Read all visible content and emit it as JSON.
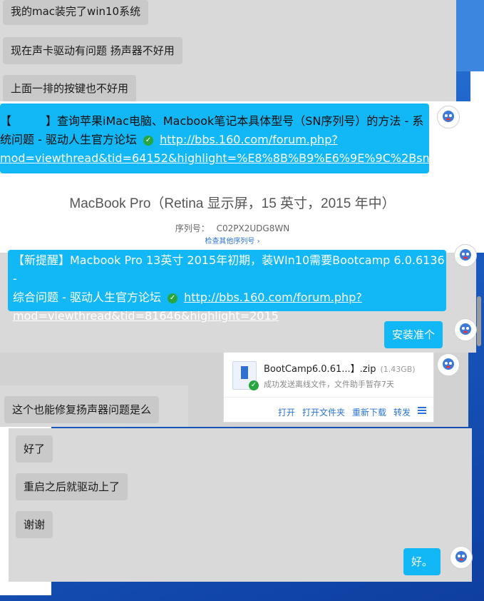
{
  "chat_top": {
    "messages": [
      "我的mac装完了win10系统",
      "现在声卡驱动有问题 扬声器不好用",
      "上面一排的按键也不好用"
    ]
  },
  "link_message_1": {
    "title": "【　　　】查询苹果iMac电脑、Macbook笔记本具体型号（SN序列号）的方法 - 系统问题 - 驱动人生官方论坛",
    "title_line1": "【　　　】查询苹果iMac电脑、Macbook笔记本具体型号（SN序列号）的方法 - 系",
    "title_line2": "统问题 - 驱动人生官方论坛",
    "url": "http://bbs.160.com/forum.php?mod=viewthread&tid=64152&highlight=%E8%8B%B9%E6%9E%9C%2Bsn",
    "url_line1": "http://bbs.160.com/forum.php?",
    "url_line2": "mod=viewthread&tid=64152&highlight=%E8%8B%B9%E6%9E%9C%2Bsn"
  },
  "mac_info": {
    "model": "MacBook Pro（Retina 显示屏，15 英寸，2015 年中）",
    "serial_label": "序列号：",
    "serial_value": "C02PX2UDG8WN",
    "serial_link": "检查其他序列号 ›"
  },
  "link_message_2": {
    "title": "【新提醒】Macbook Pro 13英寸 2015年初期，装WIn10需要Bootcamp 6.0.6136 - 综合问题 - 驱动人生官方论坛",
    "title_line1": "【新提醒】Macbook Pro 13英寸 2015年初期，装WIn10需要Bootcamp 6.0.6136 -",
    "title_line2": "综合问题 - 驱动人生官方论坛",
    "url": "http://bbs.160.com/forum.php?mod=viewthread&tid=81646&highlight=2015",
    "url_line1": "http://bbs.160.com/forum.php?",
    "url_line2": "mod=viewthread&tid=81646&highlight=2015"
  },
  "reply_install": "安装准个",
  "file": {
    "name": "BootCamp6.0.61...】.zip",
    "size": "(1.43GB)",
    "status": "成功发送离线文件，文件助手暂存7天",
    "actions": [
      "打开",
      "打开文件夹",
      "重新下载",
      "转发"
    ],
    "menu_icon": "hamburger-icon"
  },
  "question_speaker": "这个也能修复扬声器问题是么",
  "chat_bottom": {
    "messages": [
      "好了",
      "重启之后就驱动上了",
      "谢谢"
    ]
  },
  "reply_ok": "好。",
  "colors": {
    "bubble_blue": "#12b7f5",
    "bubble_gray": "#c9c9c9",
    "panel_gray": "#d9d9d9",
    "link_blue": "#2a72d6"
  }
}
